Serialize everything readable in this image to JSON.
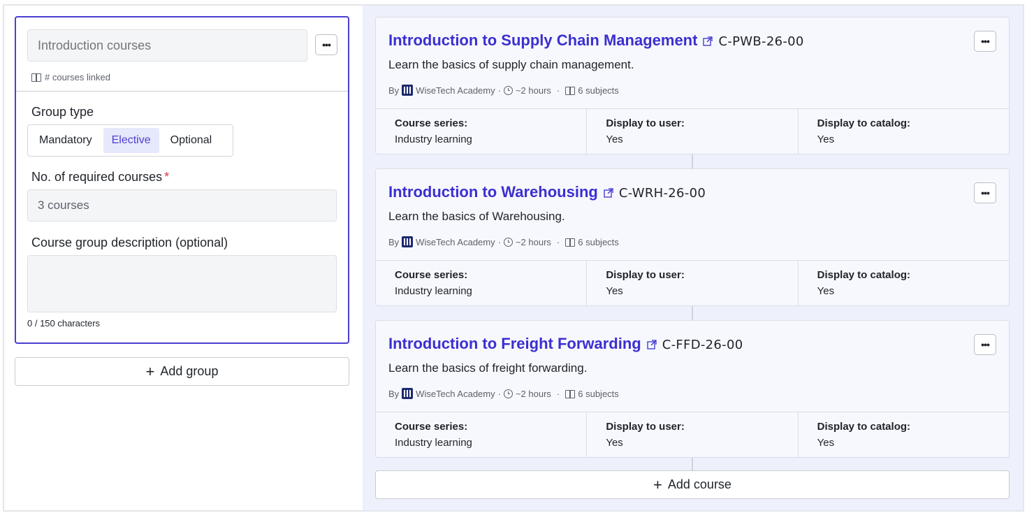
{
  "group": {
    "name_placeholder": "Introduction courses",
    "more_label": "•••",
    "linked_meta": "# courses linked",
    "group_type_label": "Group type",
    "group_types": [
      "Mandatory",
      "Elective",
      "Optional"
    ],
    "selected_group_type": "Elective",
    "required_label": "No. of required courses",
    "required_star": "*",
    "required_value": "3 courses",
    "description_label": "Course group description (optional)",
    "description_value": "",
    "char_count": "0 / 150 characters"
  },
  "add_group_label": "Add group",
  "add_course_label": "Add course",
  "plus_glyph": "+",
  "courses": [
    {
      "title": "Introduction to Supply Chain Management",
      "code": "C-PWB-26-00",
      "description": "Learn the basics of supply chain management.",
      "by": "By",
      "provider": "WiseTech Academy",
      "duration": "~2 hours",
      "subjects": "6 subjects",
      "series_label": "Course series:",
      "series_value": "Industry learning",
      "display_user_label": "Display to user:",
      "display_user_value": "Yes",
      "display_catalog_label": "Display to catalog:",
      "display_catalog_value": "Yes"
    },
    {
      "title": "Introduction to Warehousing",
      "code": "C-WRH-26-00",
      "description": "Learn the basics of Warehousing.",
      "by": "By",
      "provider": "WiseTech Academy",
      "duration": "~2 hours",
      "subjects": "6 subjects",
      "series_label": "Course series:",
      "series_value": "Industry learning",
      "display_user_label": "Display to user:",
      "display_user_value": "Yes",
      "display_catalog_label": "Display to catalog:",
      "display_catalog_value": "Yes"
    },
    {
      "title": "Introduction to Freight Forwarding",
      "code": "C-FFD-26-00",
      "description": "Learn the basics of freight forwarding.",
      "by": "By",
      "provider": "WiseTech Academy",
      "duration": "~2 hours",
      "subjects": "6 subjects",
      "series_label": "Course series:",
      "series_value": "Industry learning",
      "display_user_label": "Display to user:",
      "display_user_value": "Yes",
      "display_catalog_label": "Display to catalog:",
      "display_catalog_value": "Yes"
    }
  ],
  "meta_separator": "·",
  "colors": {
    "accent": "#4b3fd0",
    "title": "#3c2fd0",
    "panel_bg": "#eef0fb",
    "required": "#d93a3a"
  },
  "icons": [
    "more-icon",
    "book-icon",
    "external-link-icon",
    "clock-icon",
    "provider-logo-icon",
    "plus-icon"
  ]
}
